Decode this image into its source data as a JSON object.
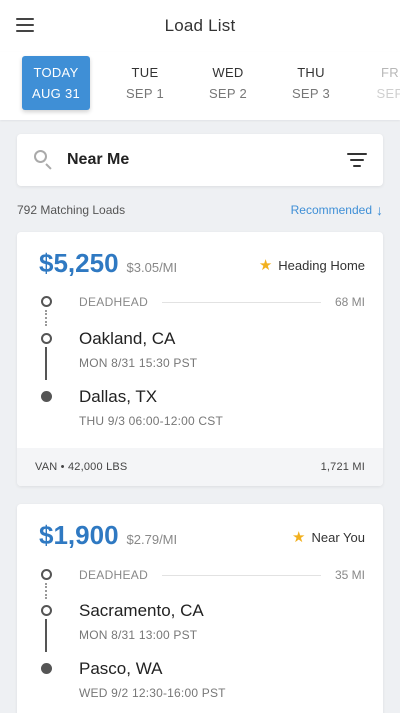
{
  "header": {
    "title": "Load List",
    "menu_icon": "hamburger-icon"
  },
  "dates": [
    {
      "day": "TODAY",
      "date": "AUG 31",
      "active": true
    },
    {
      "day": "TUE",
      "date": "SEP 1"
    },
    {
      "day": "WED",
      "date": "SEP 2"
    },
    {
      "day": "THU",
      "date": "SEP 3"
    },
    {
      "day": "FR",
      "date": "SEP"
    }
  ],
  "search": {
    "value": "Near Me",
    "icon": "search-icon",
    "filter_icon": "filter-icon"
  },
  "results": {
    "count": "792 Matching Loads",
    "sort_label": "Recommended",
    "sort_icon": "arrow-down-icon"
  },
  "colors": {
    "accent": "#3f8fd6",
    "price": "#2f79c2",
    "star": "#f2b01e"
  },
  "loads": [
    {
      "price": "$5,250",
      "per_mile": "$3.05/MI",
      "tag": "Heading Home",
      "deadhead_label": "DEADHEAD",
      "deadhead_mi": "68 MI",
      "origin_city": "Oakland, CA",
      "origin_time": "MON 8/31  15:30 PST",
      "dest_city": "Dallas, TX",
      "dest_time": "THU 9/3  06:00-12:00 CST",
      "equipment": "VAN  •  42,000 LBS",
      "distance": "1,721 MI"
    },
    {
      "price": "$1,900",
      "per_mile": "$2.79/MI",
      "tag": "Near You",
      "deadhead_label": "DEADHEAD",
      "deadhead_mi": "35 MI",
      "origin_city": "Sacramento, CA",
      "origin_time": "MON 8/31  13:00 PST",
      "dest_city": "Pasco, WA",
      "dest_time": "WED 9/2  12:30-16:00 PST"
    }
  ]
}
